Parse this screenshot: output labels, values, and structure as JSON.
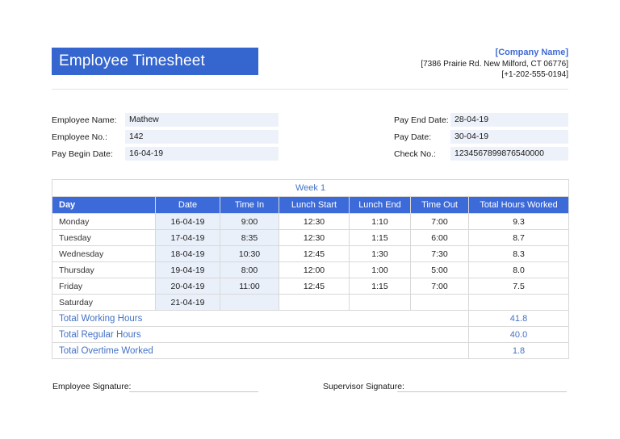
{
  "header": {
    "title": "Employee Timesheet",
    "company": {
      "name": "[Company Name]",
      "address": "[7386 Prairie Rd. New Milford, CT 06776]",
      "phone": "[+1-202-555-0194]"
    }
  },
  "info": {
    "left": [
      {
        "label": "Employee Name:",
        "value": "Mathew"
      },
      {
        "label": "Employee No.:",
        "value": "142"
      },
      {
        "label": "Pay Begin Date:",
        "value": "16-04-19"
      }
    ],
    "right": [
      {
        "label": "Pay End Date:",
        "value": "28-04-19"
      },
      {
        "label": "Pay Date:",
        "value": "30-04-19"
      },
      {
        "label": "Check No.:",
        "value": "1234567899876540000"
      }
    ]
  },
  "timesheet": {
    "week_title": "Week 1",
    "columns": [
      "Day",
      "Date",
      "Time In",
      "Lunch Start",
      "Lunch End",
      "Time Out",
      "Total Hours Worked"
    ],
    "rows": [
      {
        "day": "Monday",
        "date": "16-04-19",
        "time_in": "9:00",
        "lunch_start": "12:30",
        "lunch_end": "1:10",
        "time_out": "7:00",
        "total": "9.3"
      },
      {
        "day": "Tuesday",
        "date": "17-04-19",
        "time_in": "8:35",
        "lunch_start": "12:30",
        "lunch_end": "1:15",
        "time_out": "6:00",
        "total": "8.7"
      },
      {
        "day": "Wednesday",
        "date": "18-04-19",
        "time_in": "10:30",
        "lunch_start": "12:45",
        "lunch_end": "1:30",
        "time_out": "7:30",
        "total": "8.3"
      },
      {
        "day": "Thursday",
        "date": "19-04-19",
        "time_in": "8:00",
        "lunch_start": "12:00",
        "lunch_end": "1:00",
        "time_out": "5:00",
        "total": "8.0"
      },
      {
        "day": "Friday",
        "date": "20-04-19",
        "time_in": "11:00",
        "lunch_start": "12:45",
        "lunch_end": "1:15",
        "time_out": "7:00",
        "total": "7.5"
      },
      {
        "day": "Saturday",
        "date": "21-04-19",
        "time_in": "",
        "lunch_start": "",
        "lunch_end": "",
        "time_out": "",
        "total": ""
      }
    ],
    "totals": [
      {
        "label": "Total Working Hours",
        "value": "41.8"
      },
      {
        "label": "Total Regular Hours",
        "value": "40.0"
      },
      {
        "label": "Total Overtime Worked",
        "value": "1.8"
      }
    ]
  },
  "signatures": {
    "employee": "Employee Signature:",
    "supervisor": "Supervisor Signature:"
  },
  "colors": {
    "banner_blue": "#3565CE",
    "table_header_blue": "#3C6BD9",
    "accent_text_blue": "#4472C4",
    "field_background": "#EDF2FA",
    "tinted_cell_background": "#EAF0FA",
    "border_gray": "#D8D8D8"
  }
}
